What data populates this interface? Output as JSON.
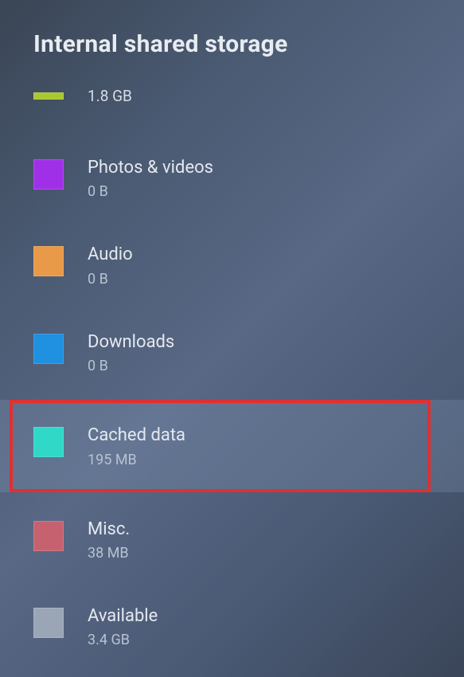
{
  "header": {
    "title": "Internal shared storage"
  },
  "storage": {
    "items": [
      {
        "label": "",
        "size": "1.8 GB",
        "color": "#a8c830"
      },
      {
        "label": "Photos & videos",
        "size": "0 B",
        "color": "#a030e8"
      },
      {
        "label": "Audio",
        "size": "0 B",
        "color": "#e89a48"
      },
      {
        "label": "Downloads",
        "size": "0 B",
        "color": "#2090e0"
      },
      {
        "label": "Cached data",
        "size": "195 MB",
        "color": "#30d8c8"
      },
      {
        "label": "Misc.",
        "size": "38 MB",
        "color": "#c66270"
      },
      {
        "label": "Available",
        "size": "3.4 GB",
        "color": "#9aa6b6"
      }
    ]
  }
}
